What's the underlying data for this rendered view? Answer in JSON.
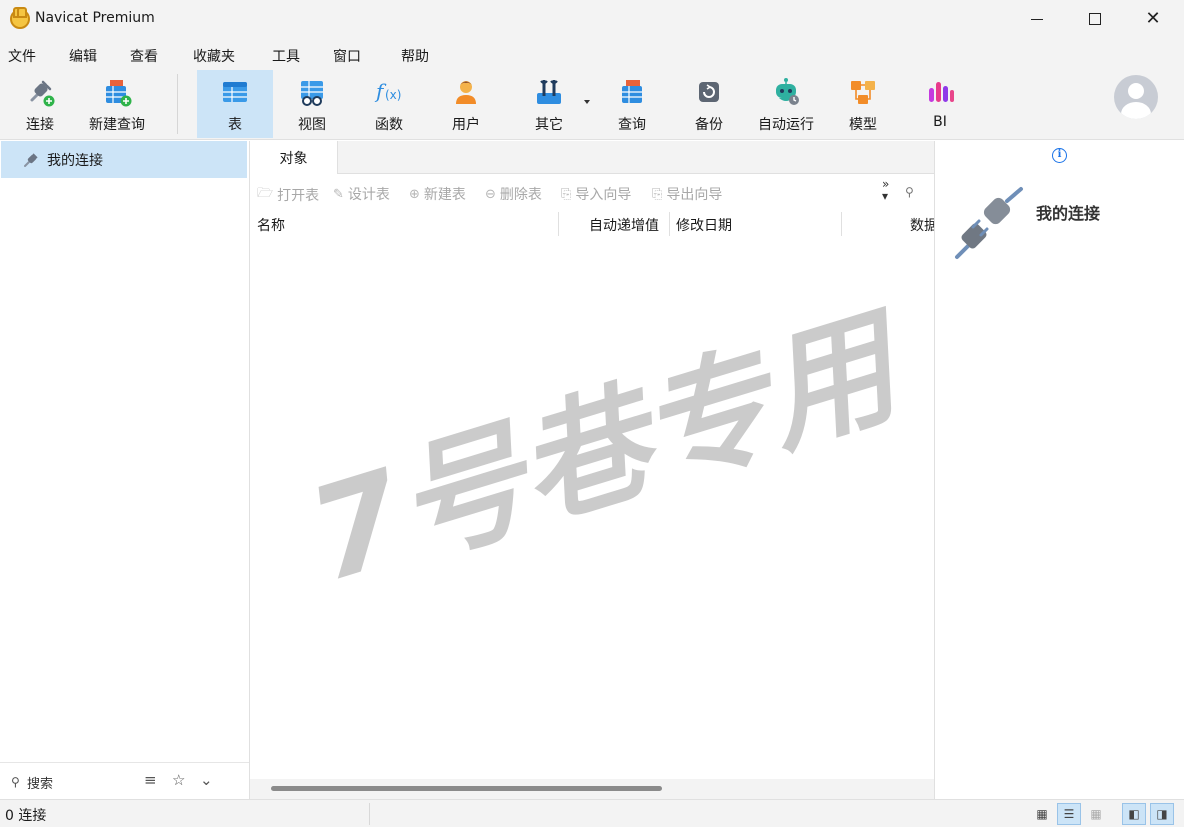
{
  "window": {
    "title": "Navicat Premium"
  },
  "menu": [
    "文件",
    "编辑",
    "查看",
    "收藏夹",
    "工具",
    "窗口",
    "帮助"
  ],
  "toolbar": {
    "connect": "连接",
    "new_query": "新建查询",
    "table": "表",
    "view": "视图",
    "function": "函数",
    "user": "用户",
    "other": "其它",
    "query": "查询",
    "backup": "备份",
    "automation": "自动运行",
    "model": "模型",
    "bi": "BI",
    "active": "表"
  },
  "sidebar": {
    "connection_group": "我的连接",
    "search_placeholder": "搜索"
  },
  "main": {
    "tab": "对象",
    "actions": [
      "打开表",
      "设计表",
      "新建表",
      "删除表",
      "导入向导",
      "导出向导"
    ],
    "columns": [
      "名称",
      "自动递增值",
      "修改日期",
      "数据"
    ]
  },
  "info_panel": {
    "title": "我的连接"
  },
  "status": {
    "text": "0 连接"
  },
  "watermark": "7号巷专用",
  "colors": {
    "accent": "#cce4f7",
    "chrome": "#f3f3f3",
    "info_blue": "#1a73e8"
  }
}
